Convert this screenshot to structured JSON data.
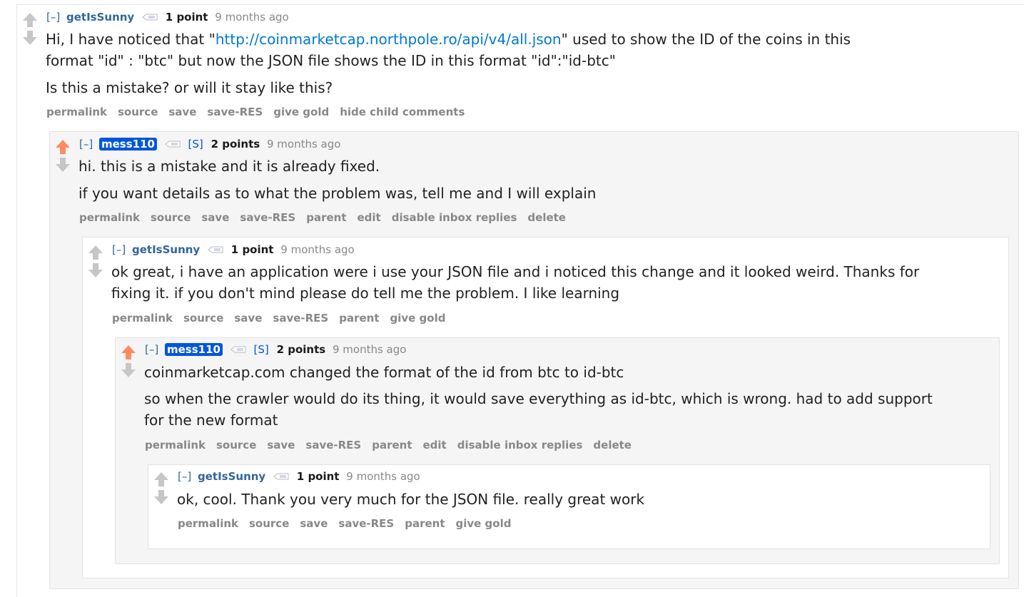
{
  "labels": {
    "collapse": "[–]",
    "submitter_flag": "[S]"
  },
  "colors": {
    "upvoted_arrow": "#ff8b60",
    "neutral_arrow": "#c6c6c6",
    "link": "#0079d3",
    "author": "#336699",
    "submitter_badge": "#0055df"
  },
  "comments": [
    {
      "author": "getIsSunny",
      "score": "1 point",
      "time": "9 months ago",
      "upvoted": false,
      "submitter": false,
      "body": {
        "p1_pre": "Hi, I have noticed that \"",
        "p1_link": "http://coinmarketcap.northpole.ro/api/v4/all.json",
        "p1_post": "\" used to show the ID of the coins in this",
        "p1_line2": "format \"id\" : \"btc\" but now the JSON file shows the ID in this format \"id\":\"id-btc\"",
        "p2": "Is this a mistake? or will it stay like this?"
      },
      "buttons": [
        "permalink",
        "source",
        "save",
        "save-RES",
        "give gold",
        "hide child comments"
      ]
    },
    {
      "author": "mess110",
      "score": "2 points",
      "time": "9 months ago",
      "upvoted": true,
      "submitter": true,
      "body": {
        "p1": "hi. this is a mistake and it is already fixed.",
        "p2": "if you want details as to what the problem was, tell me and I will explain"
      },
      "buttons": [
        "permalink",
        "source",
        "save",
        "save-RES",
        "parent",
        "edit",
        "disable inbox replies",
        "delete"
      ]
    },
    {
      "author": "getIsSunny",
      "score": "1 point",
      "time": "9 months ago",
      "upvoted": false,
      "submitter": false,
      "body": {
        "p1_line1": "ok great, i have an application were i use your JSON file and i noticed this change and it looked weird. Thanks for",
        "p1_line2": "fixing it. if you don't mind please do tell me the problem. I like learning"
      },
      "buttons": [
        "permalink",
        "source",
        "save",
        "save-RES",
        "parent",
        "give gold"
      ]
    },
    {
      "author": "mess110",
      "score": "2 points",
      "time": "9 months ago",
      "upvoted": true,
      "submitter": true,
      "body": {
        "p1": "coinmarketcap.com changed the format of the id from btc to id-btc",
        "p2_line1": "so when the crawler would do its thing, it would save everything as id-btc, which is wrong. had to add support",
        "p2_line2": "for the new format"
      },
      "buttons": [
        "permalink",
        "source",
        "save",
        "save-RES",
        "parent",
        "edit",
        "disable inbox replies",
        "delete"
      ]
    },
    {
      "author": "getIsSunny",
      "score": "1 point",
      "time": "9 months ago",
      "upvoted": false,
      "submitter": false,
      "body": {
        "p1": "ok, cool. Thank you very much for the JSON file. really great work"
      },
      "buttons": [
        "permalink",
        "source",
        "save",
        "save-RES",
        "parent",
        "give gold"
      ]
    }
  ]
}
